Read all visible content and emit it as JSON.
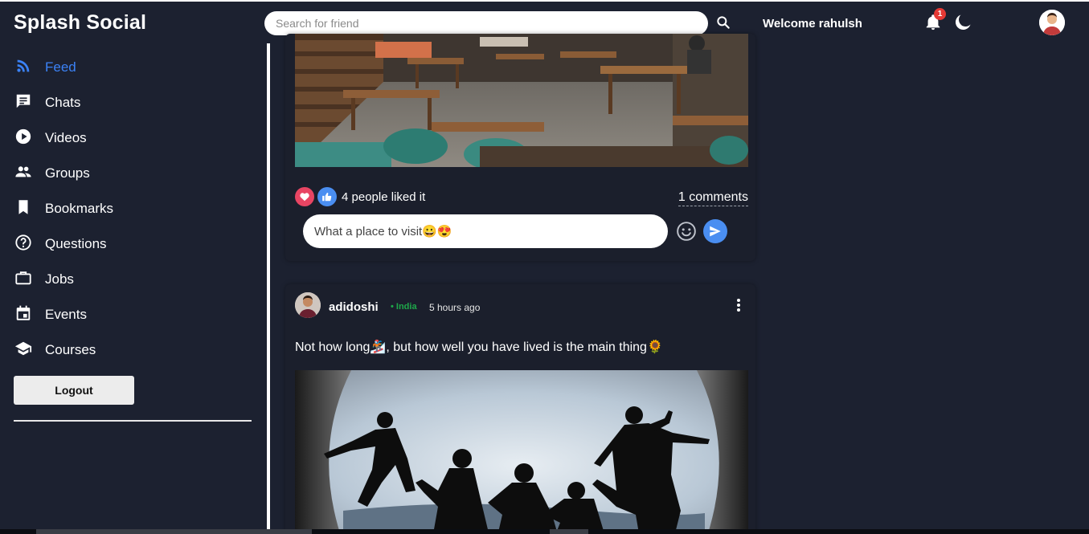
{
  "app": {
    "title": "Splash Social"
  },
  "search": {
    "placeholder": "Search for friend"
  },
  "header": {
    "welcome": "Welcome rahulsh",
    "notification_count": "1"
  },
  "sidebar": {
    "items": [
      {
        "label": "Feed",
        "icon": "rss-icon",
        "active": true
      },
      {
        "label": "Chats",
        "icon": "chat-icon"
      },
      {
        "label": "Videos",
        "icon": "play-circle-icon"
      },
      {
        "label": "Groups",
        "icon": "groups-icon"
      },
      {
        "label": "Bookmarks",
        "icon": "bookmark-icon"
      },
      {
        "label": "Questions",
        "icon": "help-circle-icon"
      },
      {
        "label": "Jobs",
        "icon": "briefcase-icon"
      },
      {
        "label": "Events",
        "icon": "calendar-icon"
      },
      {
        "label": "Courses",
        "icon": "school-icon"
      }
    ],
    "logout_label": "Logout"
  },
  "posts": [
    {
      "likes_text": "4 people liked it",
      "comments_text": "1 comments",
      "comment_value": "What a place to visit😀😍"
    },
    {
      "username": "adidoshi",
      "country": "• India",
      "time": "5 hours ago",
      "caption": "Not how long🏂, but how well you have lived is the main thing🌻"
    }
  ],
  "colors": {
    "accent": "#3b82f6",
    "background": "#1c2130",
    "like_red": "#e84563",
    "like_blue": "#4a8ef1",
    "country_green": "#1ea84a"
  }
}
